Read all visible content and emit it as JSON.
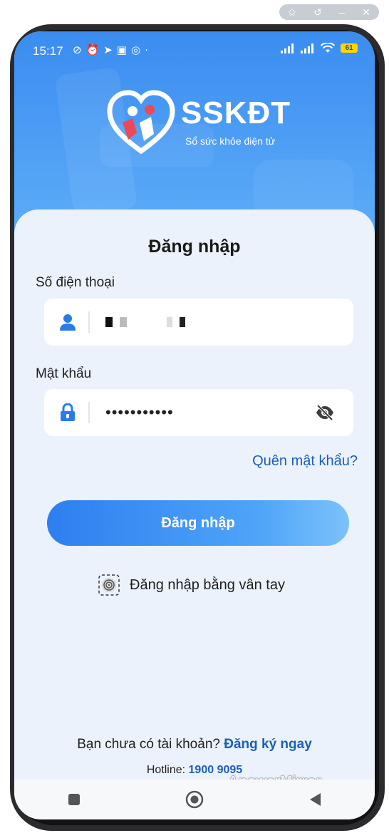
{
  "window_controls": {
    "icons": [
      "pin-icon",
      "history-icon",
      "minimize-icon",
      "close-icon"
    ]
  },
  "status_bar": {
    "time": "15:17",
    "battery": "61",
    "icons": [
      "mute-icon",
      "alarm-icon",
      "telegram-icon",
      "zalo-icon",
      "nfc-icon",
      "signal-icon",
      "signal-icon",
      "wifi-icon",
      "battery-icon"
    ]
  },
  "brand": {
    "name": "SSKĐT",
    "tagline": "Sổ sức khỏe điện tử"
  },
  "login": {
    "title": "Đăng nhập",
    "phone_label": "Số điện thoại",
    "phone_value": "",
    "password_label": "Mật khẩu",
    "password_value": "•••••••••••",
    "forgot_link": "Quên mật khẩu?",
    "submit_label": "Đăng nhập",
    "fingerprint_label": "Đăng nhập bằng vân tay"
  },
  "footer": {
    "no_account_text": "Bạn chưa có tài khoản?",
    "signup_link": "Đăng ký ngay",
    "hotline_label": "Hotline:",
    "hotline_number": "1900 9095",
    "watermark": "ApowerMirror"
  },
  "navbar": {
    "items": [
      "square-icon",
      "home-circle-icon",
      "back-triangle-icon"
    ]
  },
  "colors": {
    "primary": "#2d7ff0",
    "link": "#1b5fb8",
    "background": "#ebf2fb"
  }
}
